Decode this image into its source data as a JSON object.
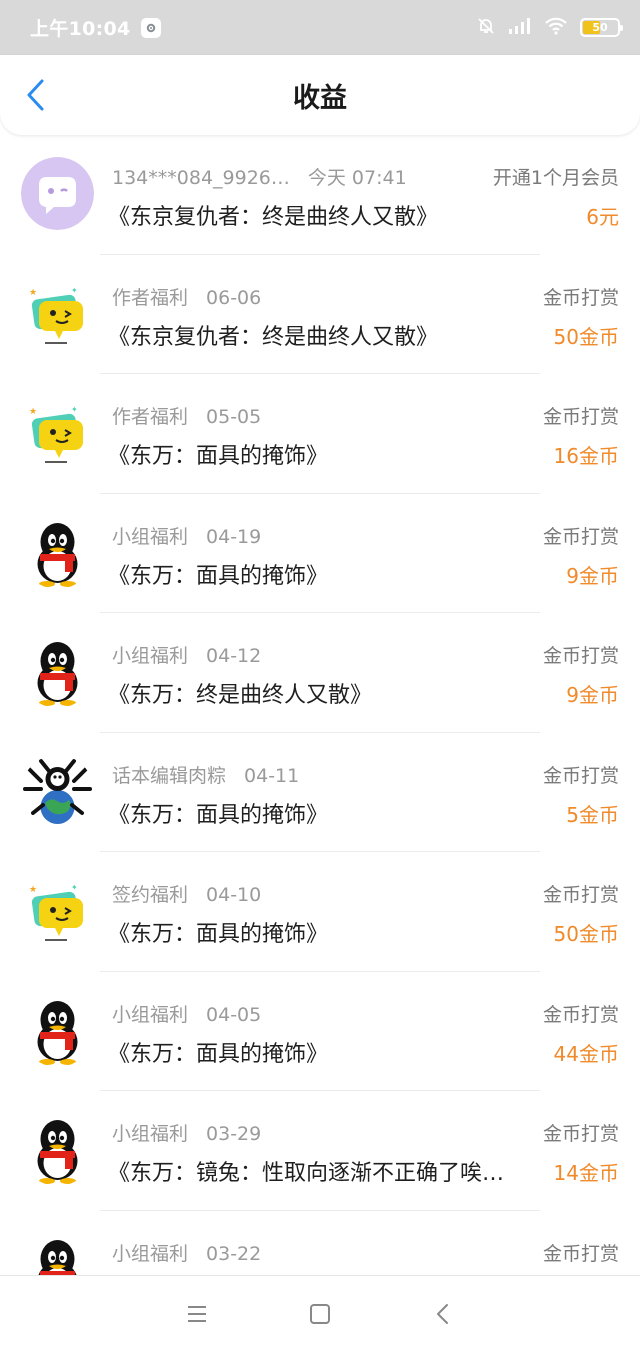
{
  "status_bar": {
    "time": "上午10:04",
    "battery_level": "50",
    "icons": [
      "settings-badge-icon",
      "mute-bell-icon",
      "signal-icon",
      "wifi-icon",
      "battery-icon"
    ]
  },
  "header": {
    "title": "收益",
    "back_icon": "chevron-left-icon"
  },
  "colors": {
    "accent": "#2a8cf0",
    "amount": "#f08a2a",
    "secondary": "#9a9a9a"
  },
  "earnings": [
    {
      "avatar": "chat-bubble-avatar",
      "source": "134***084_9926…",
      "date": "今天 07:41",
      "book": "《东京复仇者：终是曲终人又散》",
      "type": "开通1个月会员",
      "amount": "6元"
    },
    {
      "avatar": "yellow-face-avatar",
      "source": "作者福利",
      "date": "06-06",
      "book": "《东京复仇者：终是曲终人又散》",
      "type": "金币打赏",
      "amount": "50金币"
    },
    {
      "avatar": "yellow-face-avatar",
      "source": "作者福利",
      "date": "05-05",
      "book": "《东万：面具的掩饰》",
      "type": "金币打赏",
      "amount": "16金币"
    },
    {
      "avatar": "penguin-avatar",
      "source": "小组福利",
      "date": "04-19",
      "book": "《东万：面具的掩饰》",
      "type": "金币打赏",
      "amount": "9金币"
    },
    {
      "avatar": "penguin-avatar",
      "source": "小组福利",
      "date": "04-12",
      "book": "《东万：终是曲终人又散》",
      "type": "金币打赏",
      "amount": "9金币"
    },
    {
      "avatar": "globe-avatar",
      "source": "话本编辑肉粽",
      "date": "04-11",
      "book": "《东万：面具的掩饰》",
      "type": "金币打赏",
      "amount": "5金币"
    },
    {
      "avatar": "yellow-face-avatar",
      "source": "签约福利",
      "date": "04-10",
      "book": "《东万：面具的掩饰》",
      "type": "金币打赏",
      "amount": "50金币"
    },
    {
      "avatar": "penguin-avatar",
      "source": "小组福利",
      "date": "04-05",
      "book": "《东万：面具的掩饰》",
      "type": "金币打赏",
      "amount": "44金币"
    },
    {
      "avatar": "penguin-avatar",
      "source": "小组福利",
      "date": "03-29",
      "book": "《东万：镜兔：性取向逐渐不正确了唉…",
      "type": "金币打赏",
      "amount": "14金币"
    },
    {
      "avatar": "penguin-avatar",
      "source": "小组福利",
      "date": "03-22",
      "book": "",
      "type": "金币打赏",
      "amount": ""
    }
  ],
  "nav_bar": {
    "icons": [
      "menu-icon",
      "home-square-icon",
      "back-triangle-icon"
    ]
  }
}
